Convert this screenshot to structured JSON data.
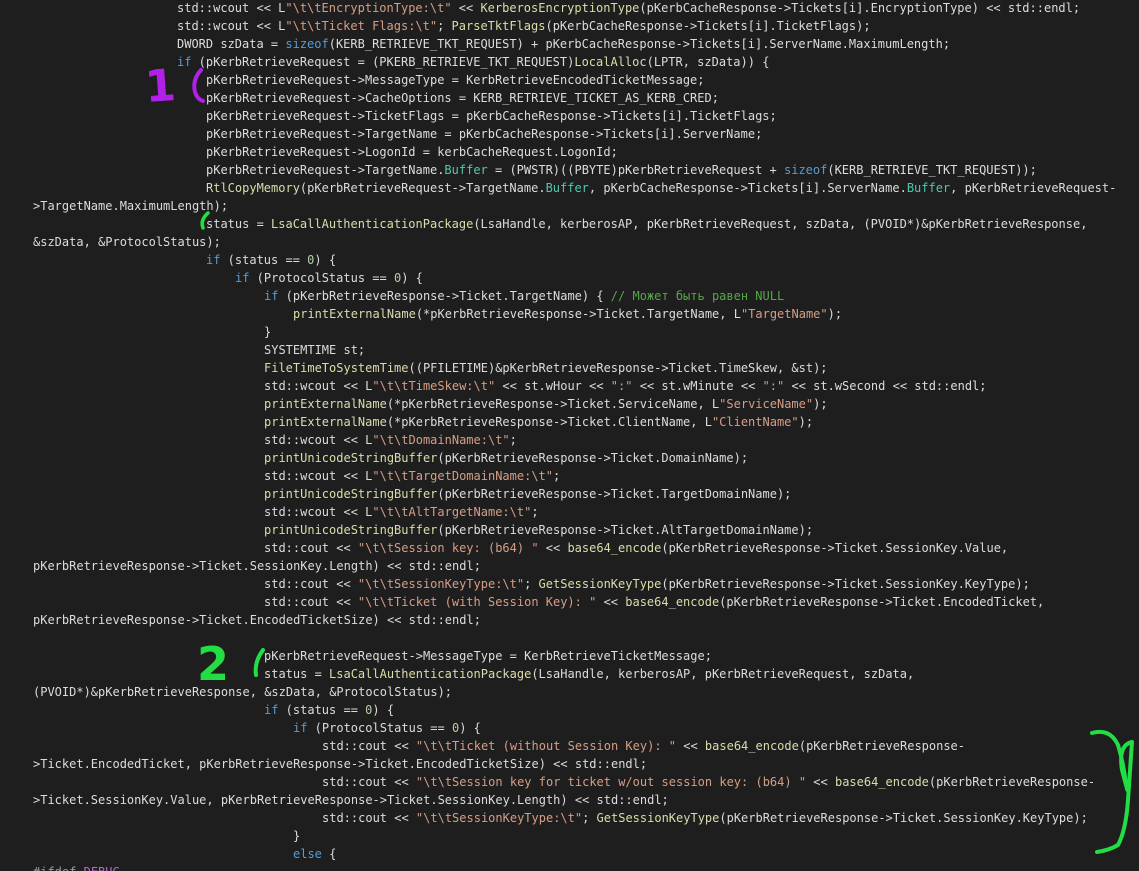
{
  "code": {
    "lines": [
      {
        "indent": 177,
        "tokens": [
          [
            "std::wcout << L",
            ""
          ],
          [
            "\"\\t\\tEncryptionType:\\t\"",
            "str"
          ],
          [
            " << ",
            ""
          ],
          [
            "KerberosEncryptionType",
            "fn"
          ],
          [
            "(pKerbCacheResponse->Tickets[i].EncryptionType) << std::endl;",
            ""
          ]
        ]
      },
      {
        "indent": 177,
        "tokens": [
          [
            "std::wcout << L",
            ""
          ],
          [
            "\"\\t\\tTicket Flags:\\t\"",
            "str"
          ],
          [
            "; ",
            ""
          ],
          [
            "ParseTktFlags",
            "fn"
          ],
          [
            "(pKerbCacheResponse->Tickets[i].TicketFlags);",
            ""
          ]
        ]
      },
      {
        "indent": 177,
        "tokens": [
          [
            "DWORD szData = ",
            ""
          ],
          [
            "sizeof",
            "kw"
          ],
          [
            "(KERB_RETRIEVE_TKT_REQUEST) + pKerbCacheResponse->Tickets[i].ServerName.MaximumLength;",
            ""
          ]
        ]
      },
      {
        "indent": 177,
        "tokens": [
          [
            "if",
            "kw"
          ],
          [
            " (pKerbRetrieveRequest = (PKERB_RETRIEVE_TKT_REQUEST)",
            ""
          ],
          [
            "LocalAlloc",
            "fn"
          ],
          [
            "(LPTR, szData)) {",
            ""
          ]
        ]
      },
      {
        "indent": 206,
        "tokens": [
          [
            "pKerbRetrieveRequest->MessageType = KerbRetrieveEncodedTicketMessage;",
            ""
          ]
        ]
      },
      {
        "indent": 206,
        "tokens": [
          [
            "pKerbRetrieveRequest->CacheOptions = KERB_RETRIEVE_TICKET_AS_KERB_CRED;",
            ""
          ]
        ]
      },
      {
        "indent": 206,
        "tokens": [
          [
            "pKerbRetrieveRequest->TicketFlags = pKerbCacheResponse->Tickets[i].TicketFlags;",
            ""
          ]
        ]
      },
      {
        "indent": 206,
        "tokens": [
          [
            "pKerbRetrieveRequest->TargetName = pKerbCacheResponse->Tickets[i].ServerName;",
            ""
          ]
        ]
      },
      {
        "indent": 206,
        "tokens": [
          [
            "pKerbRetrieveRequest->LogonId = kerbCacheRequest.LogonId;",
            ""
          ]
        ]
      },
      {
        "indent": 206,
        "tokens": [
          [
            "pKerbRetrieveRequest->TargetName.",
            ""
          ],
          [
            "Buffer",
            "mem"
          ],
          [
            " = (PWSTR)((PBYTE)pKerbRetrieveRequest + ",
            ""
          ],
          [
            "sizeof",
            "kw"
          ],
          [
            "(KERB_RETRIEVE_TKT_REQUEST));",
            ""
          ]
        ]
      },
      {
        "indent": 206,
        "tokens": [
          [
            "RtlCopyMemory",
            "fn"
          ],
          [
            "(pKerbRetrieveRequest->TargetName.",
            ""
          ],
          [
            "Buffer",
            "mem"
          ],
          [
            ", pKerbCacheResponse->Tickets[i].ServerName.",
            ""
          ],
          [
            "Buffer",
            "mem"
          ],
          [
            ", pKerbRetrieveRequest-",
            ""
          ]
        ]
      },
      {
        "indent": 33,
        "tokens": [
          [
            ">TargetName.MaximumLength);",
            ""
          ]
        ]
      },
      {
        "indent": 206,
        "tokens": [
          [
            "status = ",
            ""
          ],
          [
            "LsaCallAuthenticationPackage",
            "fn"
          ],
          [
            "(LsaHandle, kerberosAP, pKerbRetrieveRequest, szData, (PVOID*)&pKerbRetrieveResponse,",
            ""
          ]
        ]
      },
      {
        "indent": 33,
        "tokens": [
          [
            "&szData, &ProtocolStatus);",
            ""
          ]
        ]
      },
      {
        "indent": 206,
        "tokens": [
          [
            "if",
            "kw"
          ],
          [
            " (status == ",
            ""
          ],
          [
            "0",
            "num"
          ],
          [
            ") {",
            ""
          ]
        ]
      },
      {
        "indent": 235,
        "tokens": [
          [
            "if",
            "kw"
          ],
          [
            " (ProtocolStatus == ",
            ""
          ],
          [
            "0",
            "num"
          ],
          [
            ") {",
            ""
          ]
        ]
      },
      {
        "indent": 264,
        "tokens": [
          [
            "if",
            "kw"
          ],
          [
            " (pKerbRetrieveResponse->Ticket.TargetName) { ",
            ""
          ],
          [
            "// Может быть равен NULL",
            "cm"
          ]
        ]
      },
      {
        "indent": 293,
        "tokens": [
          [
            "printExternalName",
            "fn"
          ],
          [
            "(*pKerbRetrieveResponse->Ticket.TargetName, L",
            ""
          ],
          [
            "\"TargetName\"",
            "str"
          ],
          [
            ");",
            ""
          ]
        ]
      },
      {
        "indent": 264,
        "tokens": [
          [
            "}",
            ""
          ]
        ]
      },
      {
        "indent": 264,
        "tokens": [
          [
            "SYSTEMTIME st;",
            ""
          ]
        ]
      },
      {
        "indent": 264,
        "tokens": [
          [
            "FileTimeToSystemTime",
            "fn"
          ],
          [
            "((PFILETIME)&pKerbRetrieveResponse->Ticket.TimeSkew, &st);",
            ""
          ]
        ]
      },
      {
        "indent": 264,
        "tokens": [
          [
            "std::wcout << L",
            ""
          ],
          [
            "\"\\t\\tTimeSkew:\\t\"",
            "str"
          ],
          [
            " << st.wHour << ",
            ""
          ],
          [
            "\":\"",
            "str"
          ],
          [
            " << st.wMinute << ",
            ""
          ],
          [
            "\":\"",
            "str"
          ],
          [
            " << st.wSecond << std::endl;",
            ""
          ]
        ]
      },
      {
        "indent": 264,
        "tokens": [
          [
            "printExternalName",
            "fn"
          ],
          [
            "(*pKerbRetrieveResponse->Ticket.ServiceName, L",
            ""
          ],
          [
            "\"ServiceName\"",
            "str"
          ],
          [
            ");",
            ""
          ]
        ]
      },
      {
        "indent": 264,
        "tokens": [
          [
            "printExternalName",
            "fn"
          ],
          [
            "(*pKerbRetrieveResponse->Ticket.ClientName, L",
            ""
          ],
          [
            "\"ClientName\"",
            "str"
          ],
          [
            ");",
            ""
          ]
        ]
      },
      {
        "indent": 264,
        "tokens": [
          [
            "std::wcout << L",
            ""
          ],
          [
            "\"\\t\\tDomainName:\\t\"",
            "str"
          ],
          [
            ";",
            ""
          ]
        ]
      },
      {
        "indent": 264,
        "tokens": [
          [
            "printUnicodeStringBuffer",
            "fn"
          ],
          [
            "(pKerbRetrieveResponse->Ticket.DomainName);",
            ""
          ]
        ]
      },
      {
        "indent": 264,
        "tokens": [
          [
            "std::wcout << L",
            ""
          ],
          [
            "\"\\t\\tTargetDomainName:\\t\"",
            "str"
          ],
          [
            ";",
            ""
          ]
        ]
      },
      {
        "indent": 264,
        "tokens": [
          [
            "printUnicodeStringBuffer",
            "fn"
          ],
          [
            "(pKerbRetrieveResponse->Ticket.TargetDomainName);",
            ""
          ]
        ]
      },
      {
        "indent": 264,
        "tokens": [
          [
            "std::wcout << L",
            ""
          ],
          [
            "\"\\t\\tAltTargetName:\\t\"",
            "str"
          ],
          [
            ";",
            ""
          ]
        ]
      },
      {
        "indent": 264,
        "tokens": [
          [
            "printUnicodeStringBuffer",
            "fn"
          ],
          [
            "(pKerbRetrieveResponse->Ticket.AltTargetDomainName);",
            ""
          ]
        ]
      },
      {
        "indent": 264,
        "tokens": [
          [
            "std::cout << ",
            ""
          ],
          [
            "\"\\t\\tSession key: (b64) \"",
            "str"
          ],
          [
            " << ",
            ""
          ],
          [
            "base64_encode",
            "fn"
          ],
          [
            "(pKerbRetrieveResponse->Ticket.SessionKey.Value,",
            ""
          ]
        ]
      },
      {
        "indent": 33,
        "tokens": [
          [
            "pKerbRetrieveResponse->Ticket.SessionKey.Length) << std::endl;",
            ""
          ]
        ]
      },
      {
        "indent": 264,
        "tokens": [
          [
            "std::cout << ",
            ""
          ],
          [
            "\"\\t\\tSessionKeyType:\\t\"",
            "str"
          ],
          [
            "; ",
            ""
          ],
          [
            "GetSessionKeyType",
            "fn"
          ],
          [
            "(pKerbRetrieveResponse->Ticket.SessionKey.KeyType);",
            ""
          ]
        ]
      },
      {
        "indent": 264,
        "tokens": [
          [
            "std::cout << ",
            ""
          ],
          [
            "\"\\t\\tTicket (with Session Key): \"",
            "str"
          ],
          [
            " << ",
            ""
          ],
          [
            "base64_encode",
            "fn"
          ],
          [
            "(pKerbRetrieveResponse->Ticket.EncodedTicket,",
            ""
          ]
        ]
      },
      {
        "indent": 33,
        "tokens": [
          [
            "pKerbRetrieveResponse->Ticket.EncodedTicketSize) << std::endl;",
            ""
          ]
        ]
      },
      {
        "indent": 33,
        "tokens": []
      },
      {
        "indent": 264,
        "tokens": [
          [
            "pKerbRetrieveRequest->MessageType = KerbRetrieveTicketMessage;",
            ""
          ]
        ]
      },
      {
        "indent": 264,
        "tokens": [
          [
            "status = ",
            ""
          ],
          [
            "LsaCallAuthenticationPackage",
            "fn"
          ],
          [
            "(LsaHandle, kerberosAP, pKerbRetrieveRequest, szData,",
            ""
          ]
        ]
      },
      {
        "indent": 33,
        "tokens": [
          [
            "(PVOID*)&pKerbRetrieveResponse, &szData, &ProtocolStatus);",
            ""
          ]
        ]
      },
      {
        "indent": 264,
        "tokens": [
          [
            "if",
            "kw"
          ],
          [
            " (status == ",
            ""
          ],
          [
            "0",
            "num"
          ],
          [
            ") {",
            ""
          ]
        ]
      },
      {
        "indent": 293,
        "tokens": [
          [
            "if",
            "kw"
          ],
          [
            " (ProtocolStatus == ",
            ""
          ],
          [
            "0",
            "num"
          ],
          [
            ") {",
            ""
          ]
        ]
      },
      {
        "indent": 322,
        "tokens": [
          [
            "std::cout << ",
            ""
          ],
          [
            "\"\\t\\tTicket (without Session Key): \"",
            "str"
          ],
          [
            " << ",
            ""
          ],
          [
            "base64_encode",
            "fn"
          ],
          [
            "(pKerbRetrieveResponse-",
            ""
          ]
        ]
      },
      {
        "indent": 33,
        "tokens": [
          [
            ">Ticket.EncodedTicket, pKerbRetrieveResponse->Ticket.EncodedTicketSize) << std::endl;",
            ""
          ]
        ]
      },
      {
        "indent": 322,
        "tokens": [
          [
            "std::cout << ",
            ""
          ],
          [
            "\"\\t\\tSession key for ticket w/out session key: (b64) \"",
            "str"
          ],
          [
            " << ",
            ""
          ],
          [
            "base64_encode",
            "fn"
          ],
          [
            "(pKerbRetrieveResponse-",
            ""
          ]
        ]
      },
      {
        "indent": 33,
        "tokens": [
          [
            ">Ticket.SessionKey.Value, pKerbRetrieveResponse->Ticket.SessionKey.Length) << std::endl;",
            ""
          ]
        ]
      },
      {
        "indent": 322,
        "tokens": [
          [
            "std::cout << ",
            ""
          ],
          [
            "\"\\t\\tSessionKeyType:\\t\"",
            "str"
          ],
          [
            "; ",
            ""
          ],
          [
            "GetSessionKeyType",
            "fn"
          ],
          [
            "(pKerbRetrieveResponse->Ticket.SessionKey.KeyType);",
            ""
          ]
        ]
      },
      {
        "indent": 293,
        "tokens": [
          [
            "}",
            ""
          ]
        ]
      },
      {
        "indent": 293,
        "tokens": [
          [
            "else",
            "kw"
          ],
          [
            " {",
            ""
          ]
        ]
      },
      {
        "indent": 33,
        "tokens": [
          [
            "#ifdef",
            "pp"
          ],
          [
            " ",
            ""
          ],
          [
            "DEBUG",
            "mac"
          ]
        ]
      }
    ]
  },
  "annotations": {
    "mark_1": "1",
    "mark_2": "2",
    "bracket_color": "#22dd44",
    "digit_1_color": "#b020e8"
  },
  "colors": {
    "background": "#1e1e1e",
    "text": "#dcdcdc",
    "keyword": "#569cd6",
    "function": "#dcdcaa",
    "string": "#d69d85",
    "number": "#b5cea8",
    "comment": "#57a64a"
  }
}
